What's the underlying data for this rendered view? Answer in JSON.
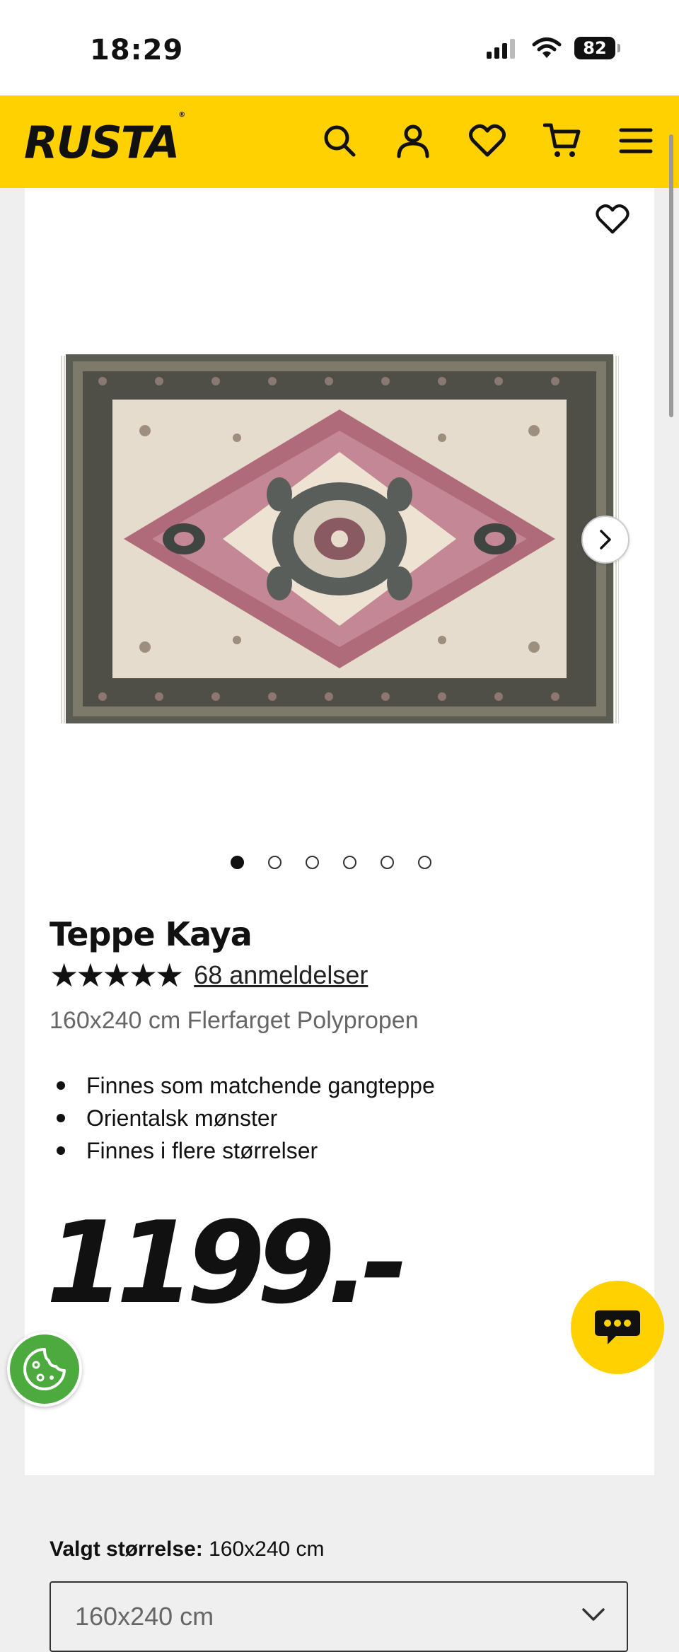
{
  "status_bar": {
    "time": "18:29",
    "battery": "82"
  },
  "header": {
    "logo": "RUSTA",
    "logo_mark": "®"
  },
  "gallery": {
    "slide_count": 6,
    "active_index": 0
  },
  "product": {
    "title": "Teppe Kaya",
    "stars": "★★★★★",
    "rating": 5,
    "reviews": "68 anmeldelser",
    "subtitle": "160x240 cm Flerfarget Polypropen",
    "features": [
      "Finnes som matchende gangteppe",
      "Orientalsk mønster",
      "Finnes i flere størrelser"
    ],
    "price": "1199.-",
    "size_label": "Valgt størrelse:",
    "size_value": "160x240 cm",
    "size_selected": "160x240 cm"
  },
  "colors": {
    "brand_yellow": "#ffd100",
    "cookie_green": "#4caa3f"
  },
  "icons": [
    "search-icon",
    "account-icon",
    "heart-icon",
    "cart-icon",
    "menu-icon",
    "chevron-right-icon",
    "chevron-down-icon",
    "chat-icon",
    "cookie-icon"
  ]
}
